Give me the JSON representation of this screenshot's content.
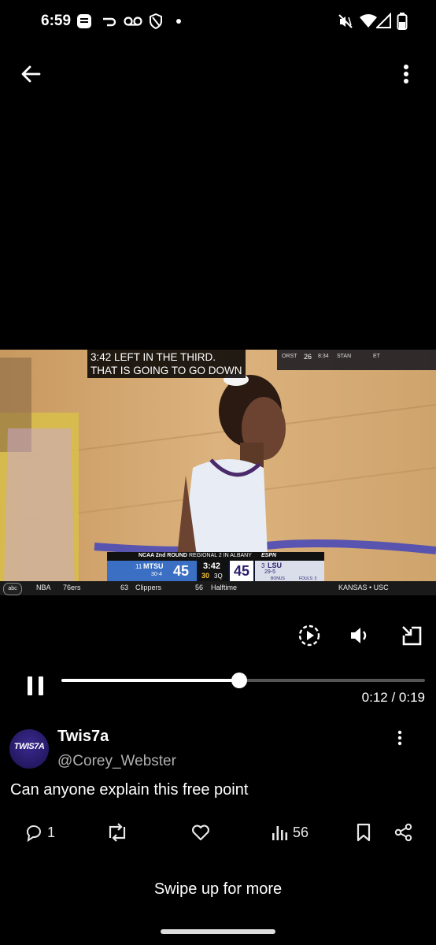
{
  "status_bar": {
    "time": "6:59"
  },
  "icons": {
    "back": "arrow-left-icon",
    "more": "more-vertical-icon",
    "replay": "replay-icon",
    "volume": "volume-icon",
    "exit_fullscreen": "exit-fullscreen-icon",
    "pause": "pause-icon",
    "reply": "reply-icon",
    "retweet": "retweet-icon",
    "like": "heart-icon",
    "views": "views-icon",
    "bookmark": "bookmark-icon",
    "share": "share-icon"
  },
  "video": {
    "caption": "3:42 LEFT IN THE THIRD.\nTHAT IS GOING TO GO DOWN",
    "scorebug": {
      "title": "NCAA 2nd ROUND",
      "region": "REGIONAL 2 IN ALBANY",
      "network": "ESPN",
      "home": {
        "seed": "11",
        "team": "MTSU",
        "record": "30-4",
        "score": "45"
      },
      "clock": "3:42",
      "shot_clock": "30",
      "period": "3Q",
      "away": {
        "seed": "3",
        "team": "LSU",
        "record": "29-5",
        "score": "45"
      },
      "bonus": "BONUS",
      "fouls": "FOULS: 3"
    },
    "top_scores": {
      "t1": "ORST",
      "s1": "26",
      "time1": "8:34",
      "t2": "STAN",
      "et": "ET"
    },
    "ticker": {
      "league": "NBA",
      "team1": "76ers",
      "score1": "63",
      "team2": "Clippers",
      "score2": "56",
      "status": "Halftime",
      "right": "KANSAS • USC"
    }
  },
  "player": {
    "progress": 0.49,
    "time_current": "0:12",
    "time_total": "0:19",
    "time_label": "0:12 / 0:19"
  },
  "tweet": {
    "avatar_text": "TWIS7A",
    "display_name": "Twis7a",
    "handle": "@Corey_Webster",
    "text": "Can anyone explain this free point",
    "replies": "1",
    "views": "56"
  },
  "footer": {
    "swipe_hint": "Swipe up for more"
  }
}
